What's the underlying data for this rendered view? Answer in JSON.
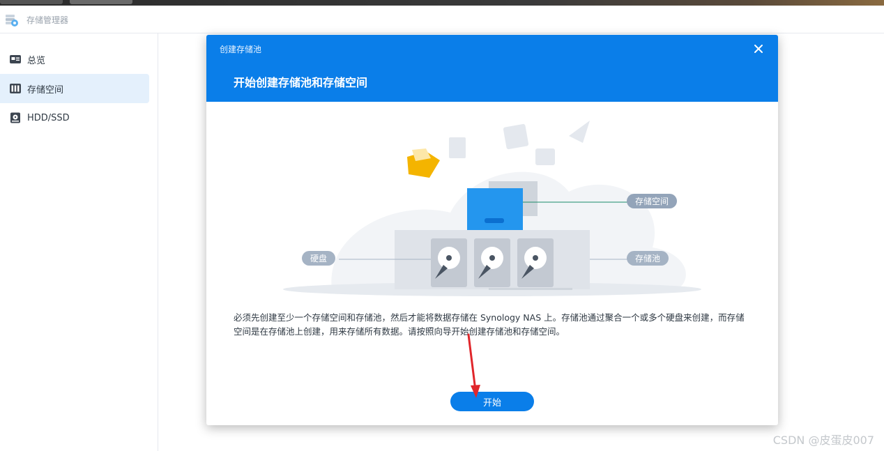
{
  "app": {
    "title": "存储管理器"
  },
  "sidebar": {
    "items": [
      {
        "label": "总览",
        "icon": "overview-icon",
        "active": false
      },
      {
        "label": "存储空间",
        "icon": "storage-icon",
        "active": true
      },
      {
        "label": "HDD/SSD",
        "icon": "disk-icon",
        "active": false
      }
    ]
  },
  "dialog": {
    "window_title": "创建存储池",
    "heading": "开始创建存储池和存储空间",
    "labels": {
      "volume": "存储空间",
      "disk": "硬盘",
      "pool": "存储池"
    },
    "description": "必须先创建至少一个存储空间和存储池，然后才能将数据存储在 Synology NAS 上。存储池通过聚合一个或多个硬盘来创建，而存储空间是在存储池上创建，用来存储所有数据。请按照向导开始创建存储池和存储空间。",
    "start_label": "开始"
  },
  "watermark": "CSDN @皮蛋皮007",
  "colors": {
    "accent": "#0a7ee9",
    "pill": "#a5b3c4",
    "arrow": "#e0262b"
  }
}
